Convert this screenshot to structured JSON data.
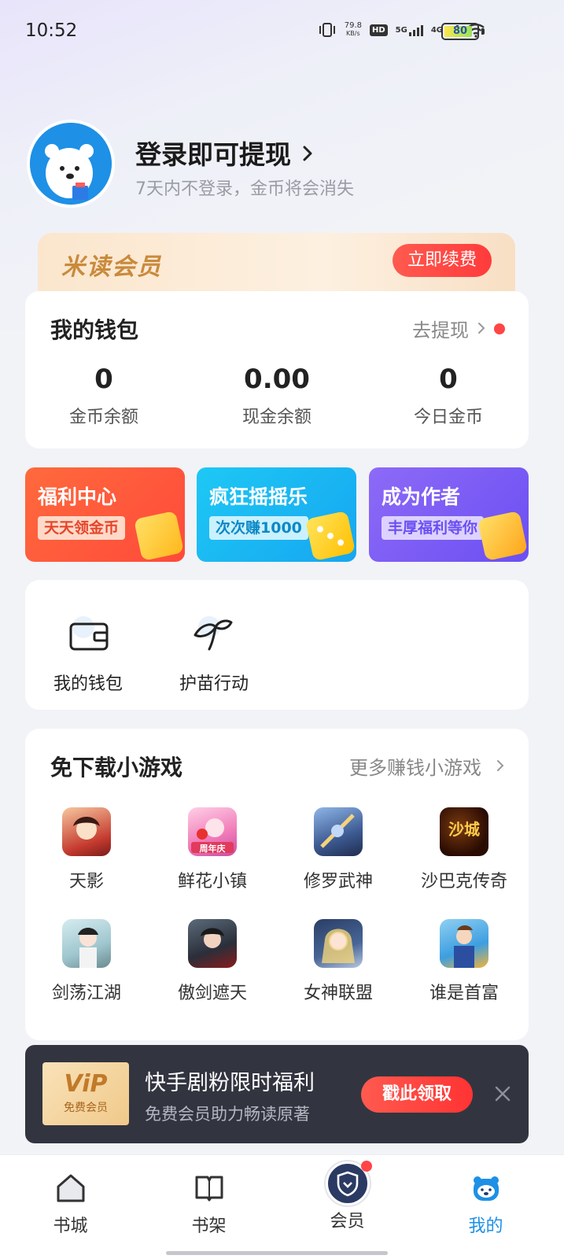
{
  "status_bar": {
    "time": "10:52",
    "net_speed_top": "79.8",
    "net_speed_bottom": "KB/s",
    "hd": "HD",
    "sim1": "5G",
    "sim2": "4G",
    "battery": "80"
  },
  "profile": {
    "title": "登录即可提现",
    "subtitle": "7天内不登录，金币将会消失"
  },
  "vip_banner": {
    "title": "米读会员",
    "button": "立即续费"
  },
  "wallet": {
    "title": "我的钱包",
    "withdraw_link": "去提现",
    "stats": [
      {
        "value": "0",
        "label": "金币余额"
      },
      {
        "value": "0.00",
        "label": "现金余额"
      },
      {
        "value": "0",
        "label": "今日金币"
      }
    ]
  },
  "promos": [
    {
      "title": "福利中心",
      "tag": "天天领金币"
    },
    {
      "title": "疯狂摇摇乐",
      "tag": "次次赚1000"
    },
    {
      "title": "成为作者",
      "tag": "丰厚福利等你"
    }
  ],
  "tools": [
    {
      "label": "我的钱包",
      "icon": "wallet-icon"
    },
    {
      "label": "护苗行动",
      "icon": "sprout-icon"
    }
  ],
  "games": {
    "title": "免下载小游戏",
    "more": "更多赚钱小游戏",
    "items": [
      {
        "label": "天影"
      },
      {
        "label": "鲜花小镇",
        "badge": "周年庆"
      },
      {
        "label": "修罗武神"
      },
      {
        "label": "沙巴克传奇",
        "badge": "沙城"
      },
      {
        "label": "剑荡江湖"
      },
      {
        "label": "傲剑遮天"
      },
      {
        "label": "女神联盟"
      },
      {
        "label": "谁是首富"
      }
    ]
  },
  "bottom_promo": {
    "vip_word": "ViP",
    "vip_caption": "免费会员",
    "title": "快手剧粉限时福利",
    "subtitle": "免费会员助力畅读原著",
    "button": "戳此领取"
  },
  "tab_bar": {
    "items": [
      {
        "label": "书城"
      },
      {
        "label": "书架"
      },
      {
        "label": "会员"
      },
      {
        "label": "我的"
      }
    ],
    "active": "我的"
  },
  "colors": {
    "accent_blue": "#1e90e6",
    "accent_red": "#ff3b3b",
    "promo1": "#ff5c3a",
    "promo2": "#1fb3f5",
    "promo3": "#7b5cf5"
  }
}
